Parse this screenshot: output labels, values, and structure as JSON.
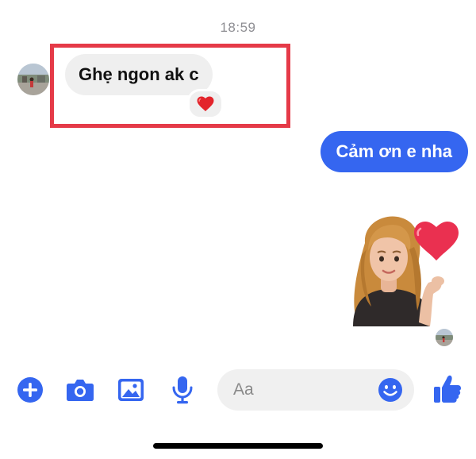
{
  "conversation": {
    "timestamp": "18:59",
    "received_message": {
      "text": "Ghẹ ngon ak c",
      "reaction": "heart"
    },
    "sent_message": {
      "text": "Cảm ơn e nha"
    },
    "sticker": {
      "name": "avatar-heart-sticker"
    }
  },
  "composer": {
    "placeholder": "Aa",
    "tools": [
      "plus-icon",
      "camera-icon",
      "image-icon",
      "microphone-icon"
    ],
    "emoji": "emoji-icon",
    "like": "thumbs-up-icon"
  },
  "colors": {
    "accent": "#3566f0",
    "received_bubble": "#efefef",
    "highlight": "#e53a48",
    "timestamp": "#8e8e93"
  }
}
